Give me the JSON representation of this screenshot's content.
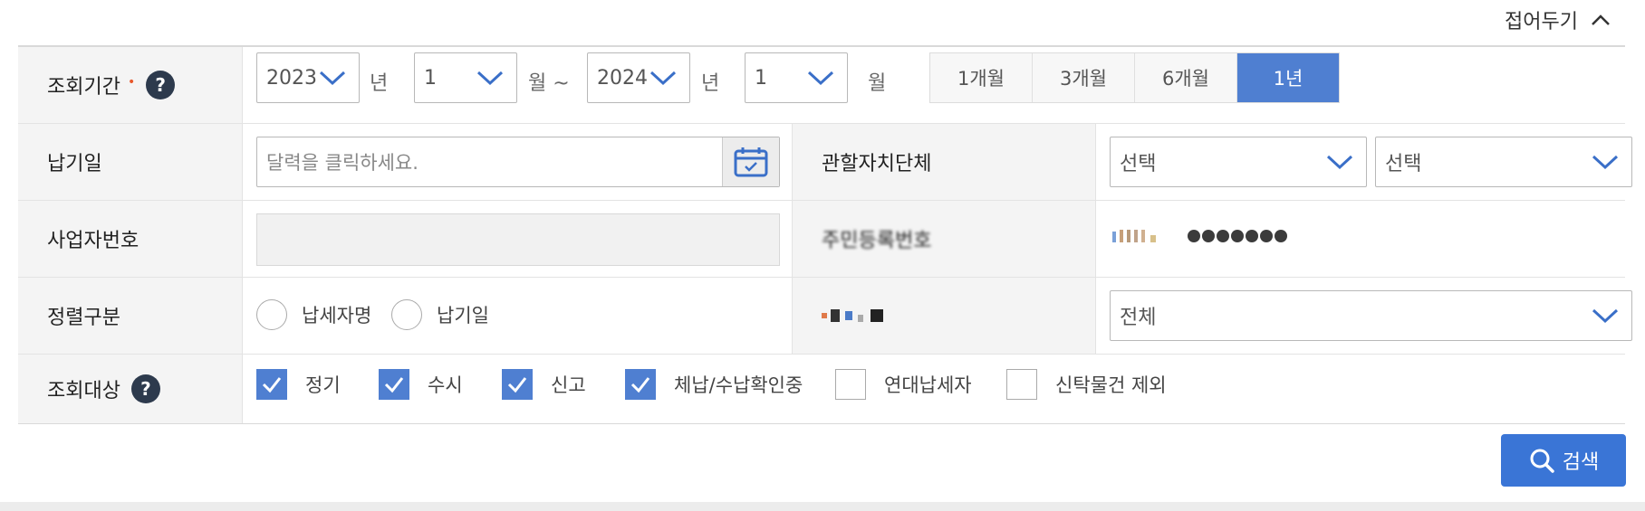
{
  "collapse_label": "접어두기",
  "period": {
    "label": "조회기간",
    "required_mark": "•",
    "help": "?",
    "from_year": "2023",
    "from_year_unit": "년",
    "from_month": "1",
    "from_month_unit": "월 ~",
    "to_year": "2024",
    "to_year_unit": "년",
    "to_month": "1",
    "to_month_unit": "월",
    "ranges": [
      "1개월",
      "3개월",
      "6개월",
      "1년"
    ]
  },
  "due_date": {
    "label": "납기일",
    "placeholder": "달력을 클릭하세요."
  },
  "jurisdiction": {
    "label": "관할자치단체",
    "select1": "선택",
    "select2": "선택"
  },
  "business_no": {
    "label": "사업자번호"
  },
  "resident_no": {
    "label": "주민등록번호"
  },
  "sort": {
    "label": "정렬구분",
    "options": [
      "납세자명",
      "납기일"
    ]
  },
  "tax_type": {
    "select": "전체"
  },
  "target": {
    "label": "조회대상",
    "help": "?",
    "options": [
      {
        "label": "정기",
        "checked": true
      },
      {
        "label": "수시",
        "checked": true
      },
      {
        "label": "신고",
        "checked": true
      },
      {
        "label": "체납/수납확인중",
        "checked": true
      },
      {
        "label": "연대납세자",
        "checked": false
      },
      {
        "label": "신탁물건 제외",
        "checked": false
      }
    ]
  },
  "search_label": "검색",
  "colors": {
    "accent": "#4f7fd1",
    "button": "#3a75d6",
    "label_bg": "#f4f4f4"
  }
}
